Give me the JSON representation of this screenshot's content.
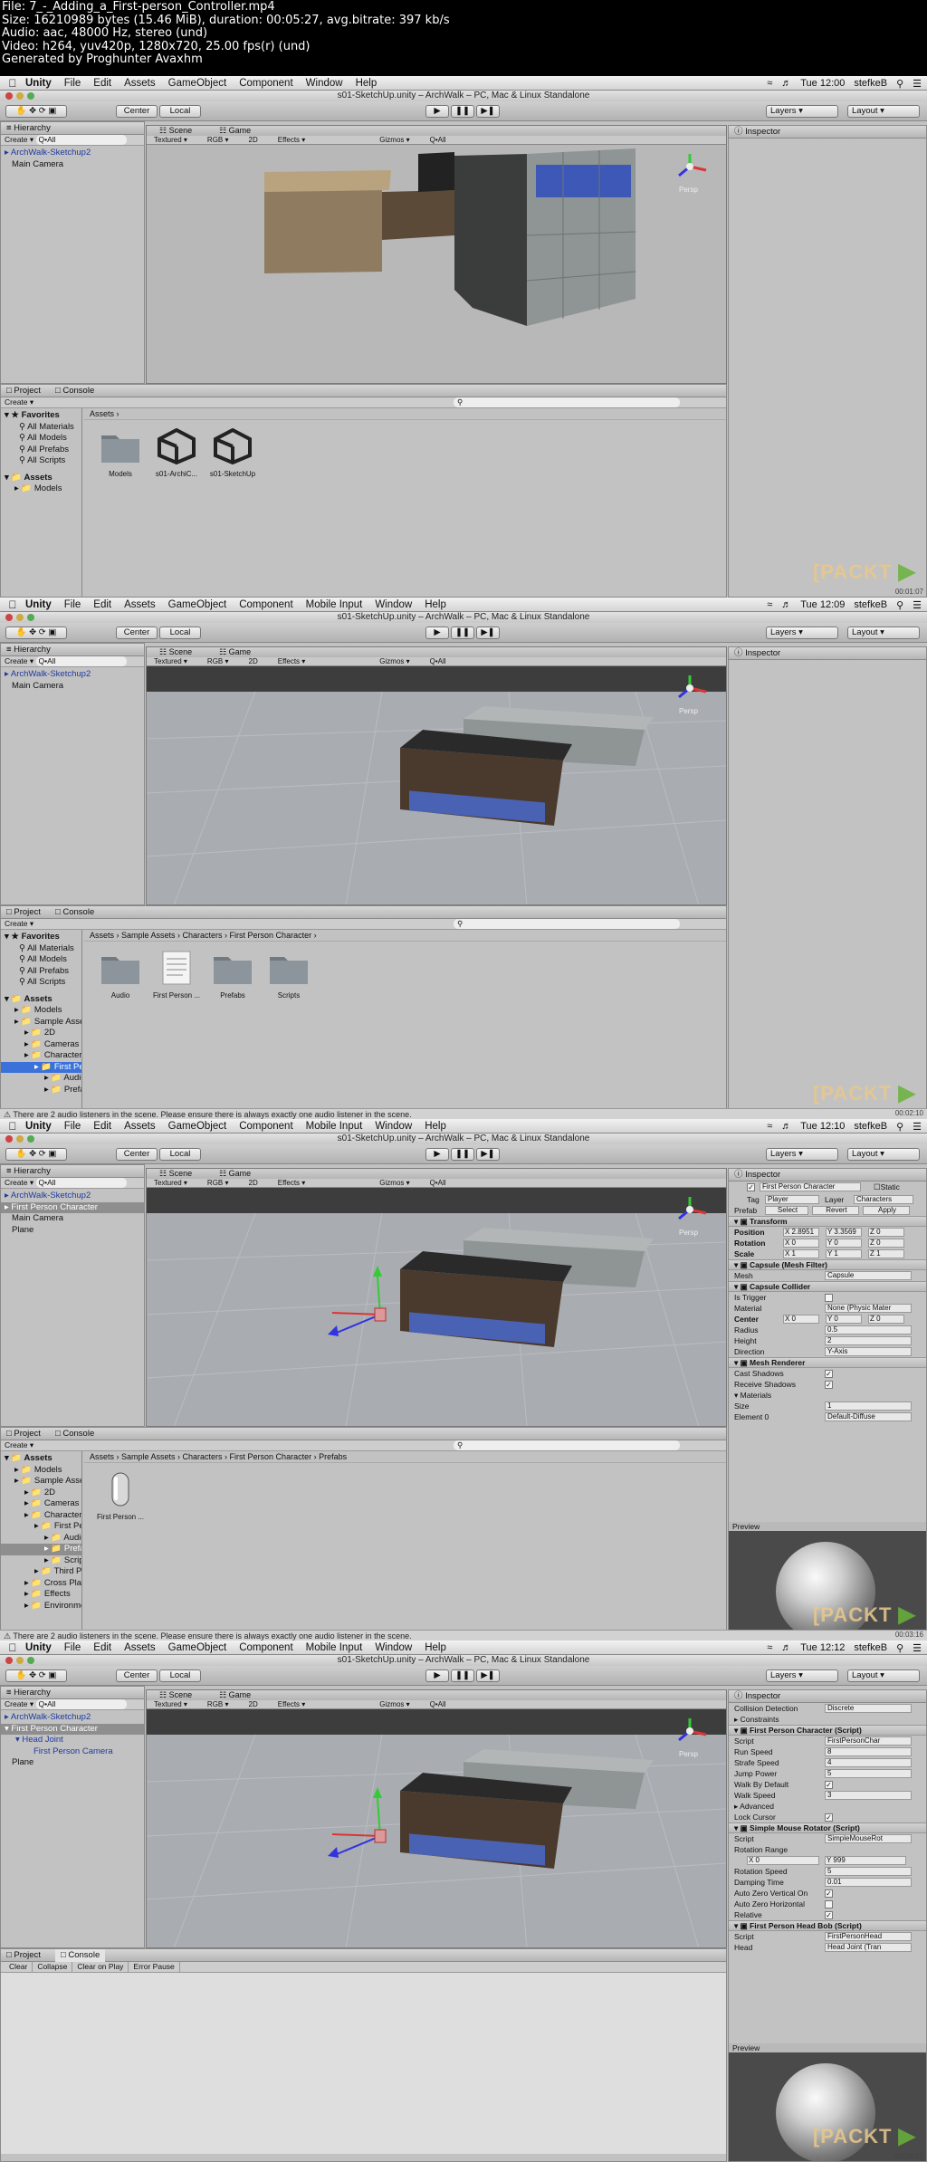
{
  "file_info": [
    "File: 7_-_Adding_a_First-person_Controller.mp4",
    "Size: 16210989 bytes (15.46 MiB), duration: 00:05:27, avg.bitrate: 397 kb/s",
    "Audio: aac, 48000 Hz, stereo (und)",
    "Video: h264, yuv420p, 1280x720, 25.00 fps(r) (und)",
    "Generated by Proghunter Avaxhm"
  ],
  "common": {
    "unity": "Unity",
    "window_title": "s01-SketchUp.unity – ArchWalk – PC, Mac & Linux Standalone",
    "center": "Center",
    "local": "Local",
    "hierarchy": "Hierarchy",
    "create": "Create",
    "all_search": "Q•All",
    "scene_tab": "Scene",
    "game_tab": "Game",
    "textured": "Textured",
    "rgb": "RGB",
    "twod": "2D",
    "effects": "Effects",
    "gizmos": "Gizmos",
    "persp": "Persp",
    "layers": "Layers",
    "layout": "Layout",
    "inspector": "Inspector",
    "project": "Project",
    "console": "Console",
    "user": "stefkeB",
    "packt": "PACKT",
    "preview": "Preview"
  },
  "menus_1": [
    "File",
    "Edit",
    "Assets",
    "GameObject",
    "Component",
    "Window",
    "Help"
  ],
  "menus_2": [
    "File",
    "Edit",
    "Assets",
    "GameObject",
    "Component",
    "Mobile Input",
    "Window",
    "Help"
  ],
  "frames": [
    {
      "clock": "Tue 12:00",
      "timestamp": "00:01:07",
      "hierarchy": [
        "ArchWalk-Sketchup2",
        "Main Camera"
      ],
      "favorites": [
        "Favorites",
        "All Materials",
        "All Models",
        "All Prefabs",
        "All Scripts"
      ],
      "assets_tree": [
        "Assets",
        "Models"
      ],
      "breadcrumb": "Assets ›",
      "assets": [
        "Models",
        "s01-ArchiC...",
        "s01-SketchUp"
      ]
    },
    {
      "clock": "Tue 12:09",
      "timestamp": "00:02:10",
      "hierarchy": [
        "ArchWalk-Sketchup2",
        "Main Camera"
      ],
      "favorites": [
        "Favorites",
        "All Materials",
        "All Models",
        "All Prefabs",
        "All Scripts"
      ],
      "assets_tree": [
        "Assets",
        "Models",
        "Sample Assets",
        "2D",
        "Cameras",
        "Characters",
        "First Person Char",
        "Audio",
        "Prefabs"
      ],
      "breadcrumb": "Assets › Sample Assets › Characters › First Person Character ›",
      "assets": [
        "Audio",
        "First Person ...",
        "Prefabs",
        "Scripts"
      ],
      "status": "There are 2 audio listeners in the scene. Please ensure there is always exactly one audio listener in the scene."
    },
    {
      "clock": "Tue 12:10",
      "timestamp": "00:03:16",
      "hierarchy": [
        "ArchWalk-Sketchup2",
        "First Person Character",
        "Main Camera",
        "Plane"
      ],
      "assets_tree": [
        "Assets",
        "Models",
        "Sample Assets",
        "2D",
        "Cameras",
        "Characters",
        "First Person Char",
        "Audio",
        "Prefabs",
        "Scripts",
        "Third Person Cha",
        "Cross Platform Inpu",
        "Effects",
        "Environment"
      ],
      "breadcrumb": "Assets › Sample Assets › Characters › First Person Character › Prefabs",
      "assets": [
        "First Person ..."
      ],
      "status": "There are 2 audio listeners in the scene. Please ensure there is always exactly one audio listener in the scene.",
      "inspector": {
        "name": "First Person Character",
        "static": "Static",
        "tag_label": "Tag",
        "tag": "Player",
        "layer_label": "Layer",
        "layer": "Characters",
        "prefab": "Prefab",
        "select": "Select",
        "revert": "Revert",
        "apply": "Apply",
        "transform": "Transform",
        "position": "Position",
        "rotation": "Rotation",
        "scale": "Scale",
        "pos": [
          "X 2.8951",
          "Y 3.3569",
          "Z 0"
        ],
        "rot": [
          "X 0",
          "Y 0",
          "Z 0"
        ],
        "scl": [
          "X 1",
          "Y 1",
          "Z 1"
        ],
        "mesh_filter": "Capsule (Mesh Filter)",
        "mesh_label": "Mesh",
        "mesh": "Capsule",
        "collider": "Capsule Collider",
        "is_trigger": "Is Trigger",
        "material_label": "Material",
        "material": "None (Physic Mater",
        "center": "Center",
        "center_vals": [
          "X 0",
          "Y 0",
          "Z 0"
        ],
        "radius_label": "Radius",
        "radius": "0.5",
        "height_label": "Height",
        "height": "2",
        "direction_label": "Direction",
        "direction": "Y-Axis",
        "renderer": "Mesh Renderer",
        "cast": "Cast Shadows",
        "receive": "Receive Shadows",
        "materials": "Materials",
        "size_label": "Size",
        "size": "1",
        "element_label": "Element 0",
        "element": "Default-Diffuse"
      }
    },
    {
      "clock": "Tue 12:12",
      "timestamp": "00:04:22",
      "hierarchy": [
        "ArchWalk-Sketchup2",
        "First Person Character",
        "Head Joint",
        "First Person Camera",
        "Plane"
      ],
      "console_buttons": [
        "Clear",
        "Collapse",
        "Clear on Play",
        "Error Pause"
      ],
      "inspector": {
        "collision_label": "Collision Detection",
        "collision": "Discrete",
        "constraints": "Constraints",
        "fpc_script": "First Person Character (Script)",
        "script_label": "Script",
        "fpc_script_value": "FirstPersonChar",
        "run_label": "Run Speed",
        "run": "8",
        "strafe_label": "Strafe Speed",
        "strafe": "4",
        "jump_label": "Jump Power",
        "jump": "5",
        "walk_by_default": "Walk By Default",
        "walk_label": "Walk Speed",
        "walk": "3",
        "advanced": "Advanced",
        "lock_cursor": "Lock Cursor",
        "smr_script": "Simple Mouse Rotator (Script)",
        "smr_value": "SimpleMouseRot",
        "rot_range": "Rotation Range",
        "range_x": "X 0",
        "range_y": "Y 999",
        "rot_speed_label": "Rotation Speed",
        "rot_speed": "5",
        "damping_label": "Damping Time",
        "damping": "0.01",
        "auto_v": "Auto Zero Vertical On",
        "auto_h": "Auto Zero Horizontal",
        "relative": "Relative",
        "headbob": "First Person Head Bob (Script)",
        "headbob_value": "FirstPersonHead",
        "head_label": "Head",
        "head": "Head Joint (Tran"
      }
    }
  ],
  "colors": {
    "accent": "#3b72d9",
    "packt_orange": "#e9c98b",
    "packt_green": "#68b23a"
  }
}
